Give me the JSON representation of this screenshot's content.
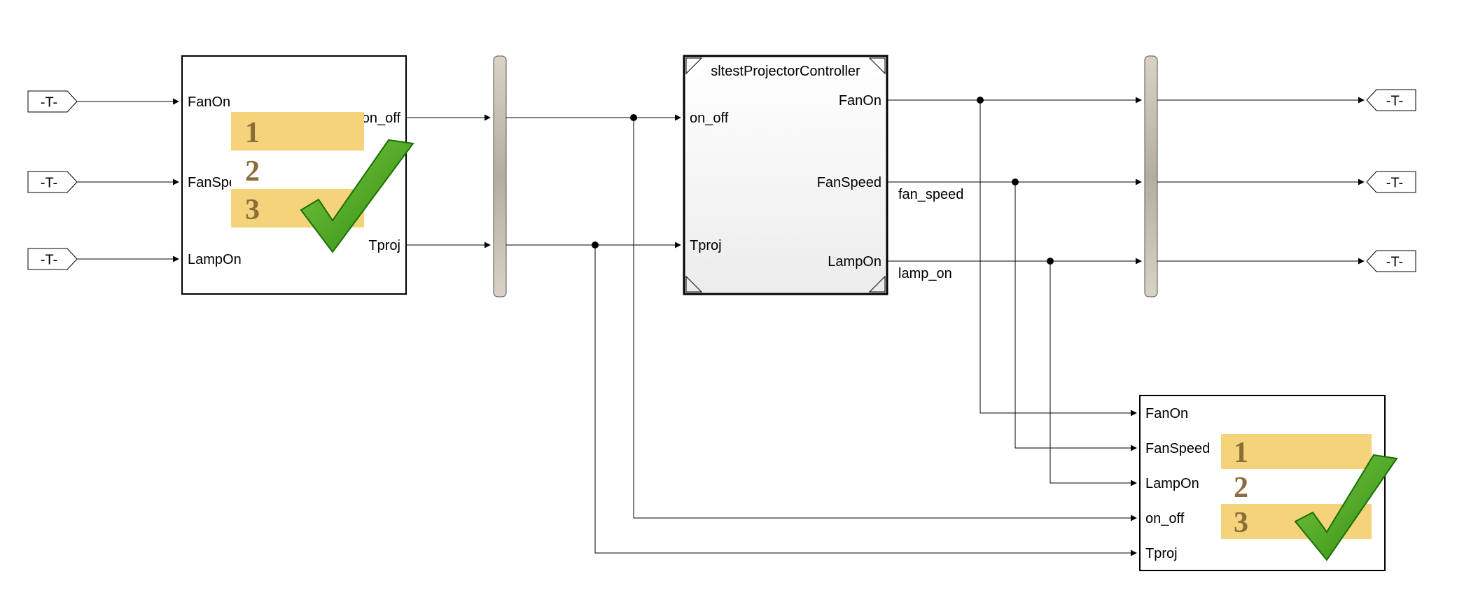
{
  "tags": {
    "in1": "-T-",
    "in2": "-T-",
    "in3": "-T-",
    "out1": "-T-",
    "out2": "-T-",
    "out3": "-T-"
  },
  "seqBlock1": {
    "ports_in": [
      "FanOn",
      "FanSpeed",
      "LampOn"
    ],
    "ports_out": [
      "on_off",
      "Tproj"
    ],
    "nums": [
      "1",
      "2",
      "3"
    ]
  },
  "controller": {
    "title": "sltestProjectorController",
    "ports_in": [
      "on_off",
      "Tproj"
    ],
    "ports_out": [
      "FanOn",
      "FanSpeed",
      "LampOn"
    ],
    "signals": [
      "fan_speed",
      "lamp_on"
    ]
  },
  "seqBlock2": {
    "ports_in": [
      "FanOn",
      "FanSpeed",
      "LampOn",
      "on_off",
      "Tproj"
    ],
    "nums": [
      "1",
      "2",
      "3"
    ]
  }
}
